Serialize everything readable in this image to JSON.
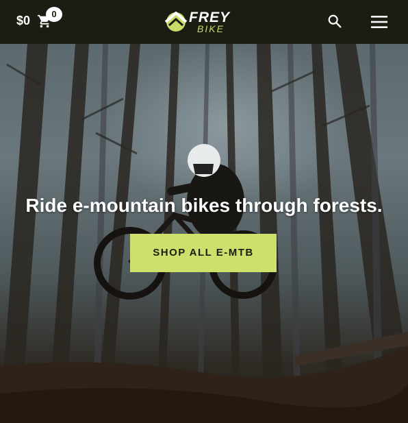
{
  "header": {
    "cart_total": "$0",
    "cart_count": "0",
    "logo_primary": "FREY",
    "logo_secondary": "BIKE",
    "icons": [
      "cart-icon",
      "search-icon",
      "hamburger-menu-icon"
    ]
  },
  "hero": {
    "headline": "Ride e-mountain bikes through forests.",
    "cta_label": "SHOP ALL E-MTB"
  },
  "colors": {
    "header_bg": "#1d1c12",
    "accent": "#cde06c",
    "text_light": "#ffffff"
  }
}
